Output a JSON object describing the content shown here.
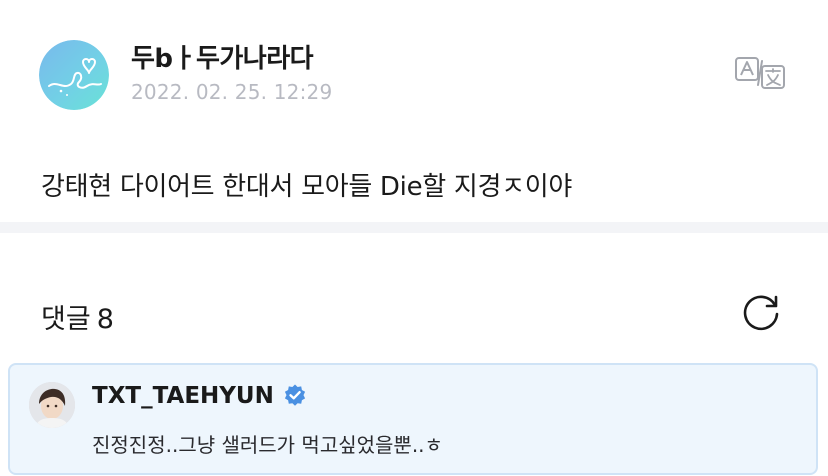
{
  "post": {
    "author_name": "두bㅏ두가나라다",
    "timestamp": "2022. 02. 25. 12:29",
    "body": "강태현 다이어트 한대서 모아들 Die할 지경ㅈ이야",
    "translate_icon": "translate-icon"
  },
  "comments": {
    "label": "댓글",
    "count": "8",
    "refresh_icon": "refresh-icon"
  },
  "comment": {
    "author": "TXT_TAEHYUN",
    "verified_icon": "verified-badge-icon",
    "text": "진정진정..그냥 샐러드가 먹고싶었을뿐..ㅎ"
  },
  "colors": {
    "card_background": "#eef6fd",
    "card_border": "#cfe3f6",
    "verified": "#4a90e2",
    "timestamp": "#b8bac2",
    "divider": "#f3f4f7"
  }
}
